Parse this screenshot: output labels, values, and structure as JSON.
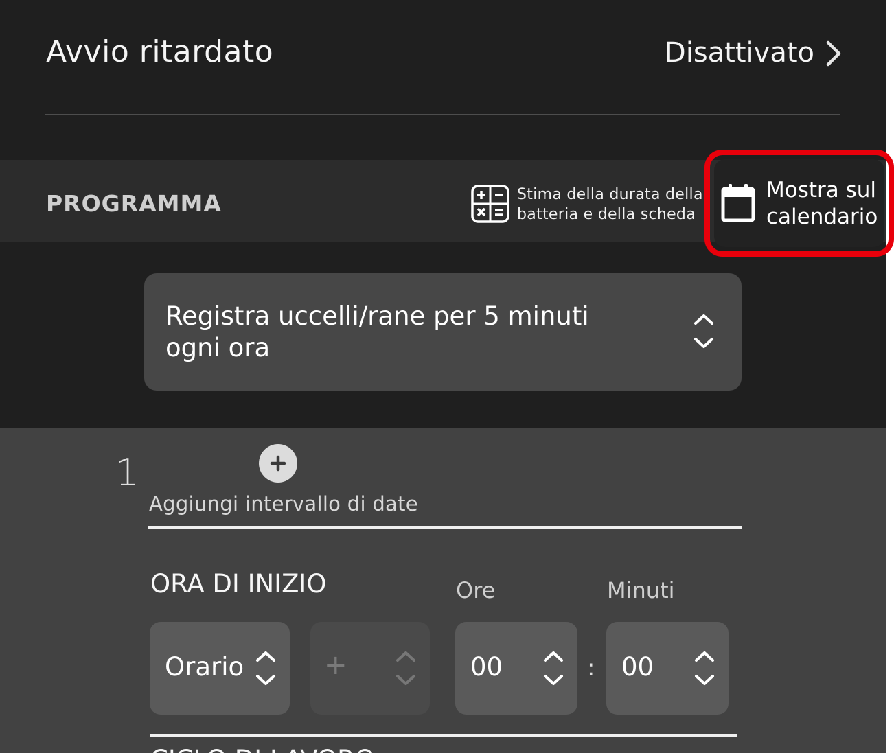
{
  "delayed_start": {
    "label": "Avvio ritardato",
    "value": "Disattivato",
    "chevron_icon": "chevron-right-icon"
  },
  "program": {
    "title": "PROGRAMMA",
    "estimate": {
      "icon": "calculator-icon",
      "line1": "Stima della durata della",
      "line2": "batteria e della scheda"
    },
    "calendar": {
      "icon": "calendar-icon",
      "line1": "Mostra sul",
      "line2": "calendario",
      "highlight_color": "#e8000b"
    },
    "preset": {
      "line1": "Registra uccelli/rane per 5 minuti",
      "line2": "ogni ora",
      "icon": "chevron-up-down-icon"
    }
  },
  "schedule": {
    "index": "1",
    "add_range_icon": "plus-circle-icon",
    "add_range_label": "Aggiungi intervallo di date",
    "start_time": {
      "title": "ORA DI INIZIO",
      "hours_label": "Ore",
      "minutes_label": "Minuti",
      "mode_value": "Orario",
      "offset_value": "+",
      "hours_value": "00",
      "separator": ":",
      "minutes_value": "00"
    },
    "next_section_title": "CICLO DI LAVORO"
  },
  "colors": {
    "background": "#1f1f1f",
    "header_band": "#2c2c2c",
    "select_bg": "#474747",
    "schedule_bg": "#424242",
    "spinner_bg": "#5a5a5a",
    "accent_highlight": "#e8000b"
  }
}
